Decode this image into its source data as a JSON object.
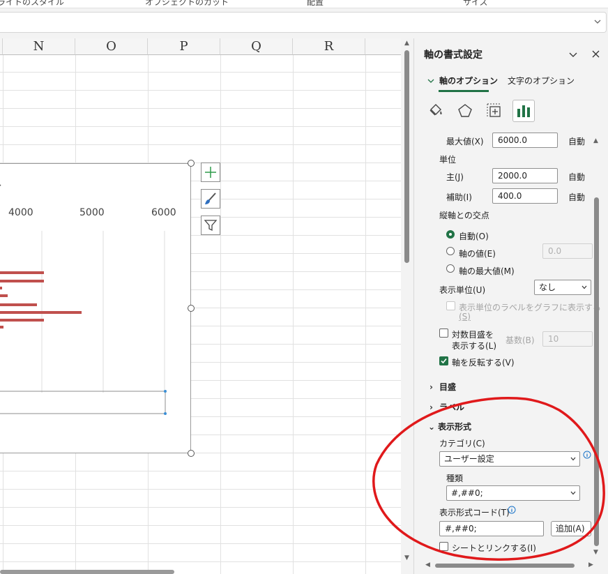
{
  "ribbon": {
    "items": [
      "ライトのスタイル",
      "オブジェクトのカット",
      "配置",
      "サイズ"
    ]
  },
  "sheet": {
    "columns": [
      "N",
      "O",
      "P",
      "Q",
      "R"
    ]
  },
  "chart": {
    "x_ticks": [
      "4000",
      "5000",
      "6000"
    ],
    "bar_color": "#c0504d",
    "side_buttons": [
      "plus-icon",
      "brush-icon",
      "filter-icon"
    ]
  },
  "pane": {
    "title": "軸の書式設定",
    "tabs": [
      "軸のオプション",
      "文字のオプション"
    ],
    "icons": [
      "fill-line-icon",
      "effects-icon",
      "size-properties-icon",
      "axis-options-icon"
    ],
    "bounds": {
      "max_label": "最大値(X)",
      "max_value": "6000.0",
      "max_auto": "自動"
    },
    "units": {
      "heading": "単位",
      "major_label": "主(J)",
      "major_value": "2000.0",
      "major_auto": "自動",
      "minor_label": "補助(I)",
      "minor_value": "400.0",
      "minor_auto": "自動"
    },
    "crosses": {
      "heading": "縦軸との交点",
      "auto": "自動(O)",
      "axis_value": "軸の値(E)",
      "axis_value_input": "0.0",
      "max_value": "軸の最大値(M)"
    },
    "display_units": {
      "label": "表示単位(U)",
      "value": "なし",
      "show_label": "表示単位のラベルをグラフに表示する",
      "show_label_key": "(S)"
    },
    "log_scale": {
      "label_line1": "対数目盛を",
      "label_line2": "表示する(L)",
      "base_label": "基数(B)",
      "base_value": "10"
    },
    "reverse": {
      "label": "軸を反転する(V)",
      "checked": true
    },
    "sections": {
      "tick_marks": "目盛",
      "labels": "ラベル",
      "number": "表示形式"
    },
    "number": {
      "category_label": "カテゴリ(C)",
      "category_value": "ユーザー設定",
      "type_label": "種類",
      "type_value": "#,##0;",
      "code_label": "表示形式コード(T)",
      "code_value": "#,##0;",
      "add_button": "追加(A)",
      "link_label": "シートとリンクする(I)"
    },
    "accent_color": "#217346"
  },
  "annotation_color": "#e0191b"
}
